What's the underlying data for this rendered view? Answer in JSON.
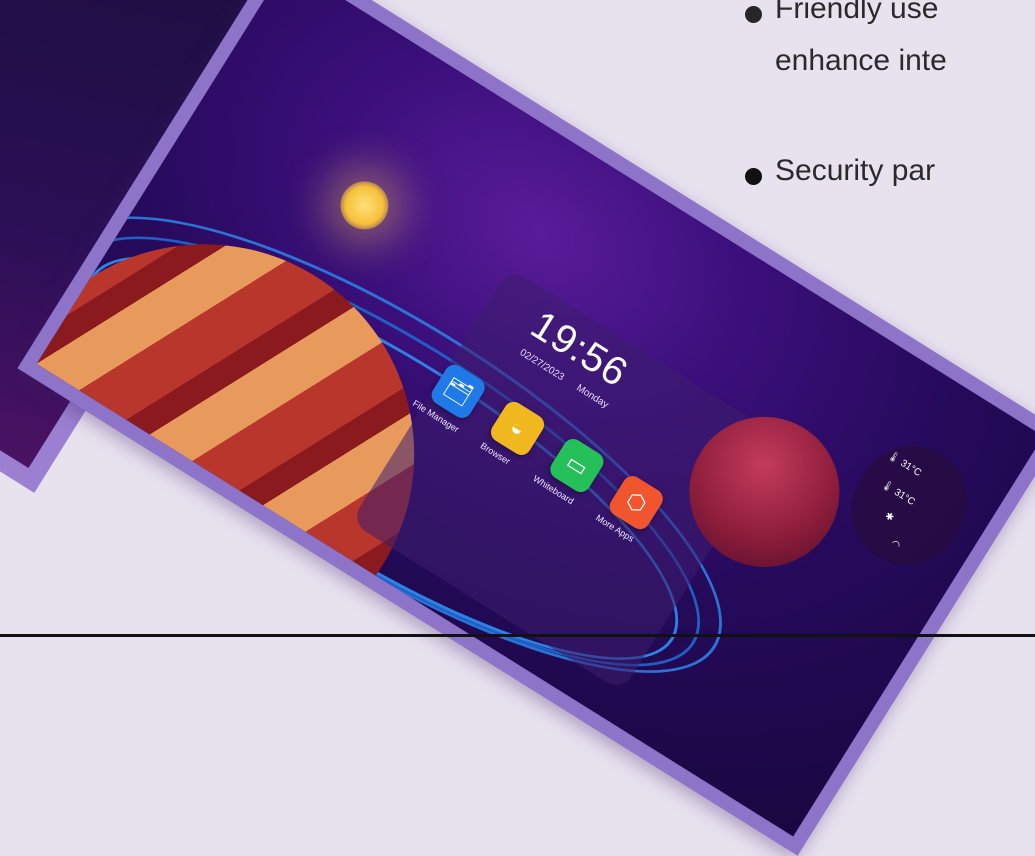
{
  "slide": {
    "bullets": [
      {
        "text": "Friendly use"
      },
      {
        "text": "enhance inte"
      },
      {
        "text": "Security par"
      }
    ]
  },
  "home": {
    "time": "19:56",
    "date": "02/27/2023",
    "weekday": "Monday",
    "apps": [
      {
        "label": "File Manager",
        "icon": "folder-icon",
        "color": "#1f7ae8"
      },
      {
        "label": "Browser",
        "icon": "browser-icon",
        "color": "#f0b81e"
      },
      {
        "label": "Whiteboard",
        "icon": "whiteboard-icon",
        "color": "#25c05a"
      },
      {
        "label": "More Apps",
        "icon": "more-apps-icon",
        "color": "#f0552e"
      }
    ],
    "status": {
      "temperature": "31°C",
      "temperature_2": "31°C"
    }
  }
}
